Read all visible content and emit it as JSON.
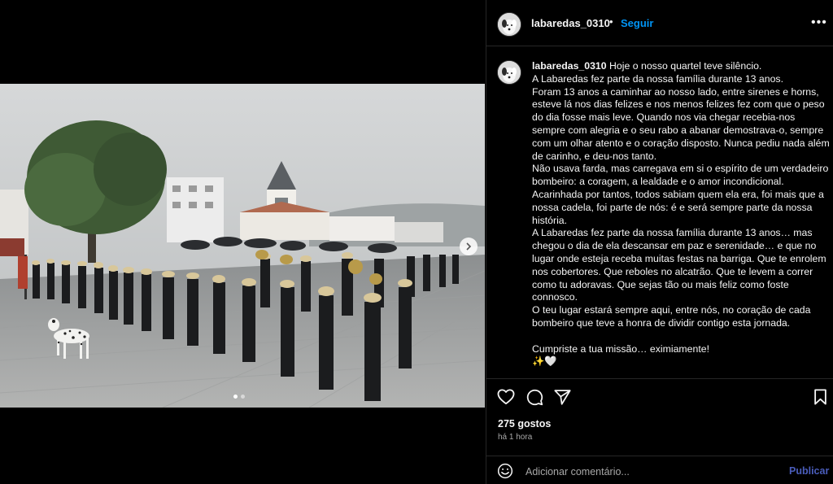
{
  "post": {
    "username": "labaredas_0310",
    "separator": "•",
    "follow_label": "Seguir",
    "more_label": "•••",
    "caption_lines": [
      "Hoje o nosso quartel teve silêncio.",
      "A Labaredas fez parte da nossa família durante 13 anos.",
      "Foram 13 anos a caminhar ao nosso lado, entre sirenes e horns, esteve lá nos dias felizes e nos menos felizes fez com que o peso do dia fosse mais leve. Quando nos via chegar recebia-nos sempre com alegria e o seu rabo a abanar demostrava-o, sempre com um olhar atento e o coração disposto. Nunca pediu nada além de carinho, e deu-nos tanto.",
      "Não usava farda, mas carregava em si o espírito de um verdadeiro bombeiro: a coragem, a lealdade e o amor incondicional.",
      "Acarinhada por tantos, todos sabiam quem ela era, foi mais que a nossa cadela, foi parte de nós: é e será sempre parte da nossa história.",
      "A Labaredas fez parte da nossa família durante 13 anos… mas chegou o dia de ela descansar em paz e serenidade… e que no lugar onde esteja receba muitas festas na barriga. Que te enrolem nos cobertores. Que reboles no alcatrão. Que te levem a correr como tu adoravas. Que sejas tão ou mais feliz como foste connosco.",
      "O teu lugar estará sempre aqui, entre nós, no coração de cada bombeiro que teve a honra de dividir contigo esta jornada.",
      "",
      "Cumpriste a tua missão… eximiamente!",
      "✨🤍"
    ],
    "likes": "275 gostos",
    "time": "há 1 hora",
    "comment_placeholder": "Adicionar comentário...",
    "publish_label": "Publicar",
    "carousel": {
      "count": 2,
      "active_index": 0
    }
  },
  "icons": {
    "like": "heart-icon",
    "comment": "comment-icon",
    "share": "send-icon",
    "save": "bookmark-icon",
    "emoji": "emoji-icon",
    "next": "chevron-right-icon"
  },
  "colors": {
    "background": "#000000",
    "text": "#f5f5f5",
    "secondary_text": "#a8a8a8",
    "follow_link": "#0095f6",
    "publish_link": "#4a5dbb",
    "border": "#262626"
  }
}
